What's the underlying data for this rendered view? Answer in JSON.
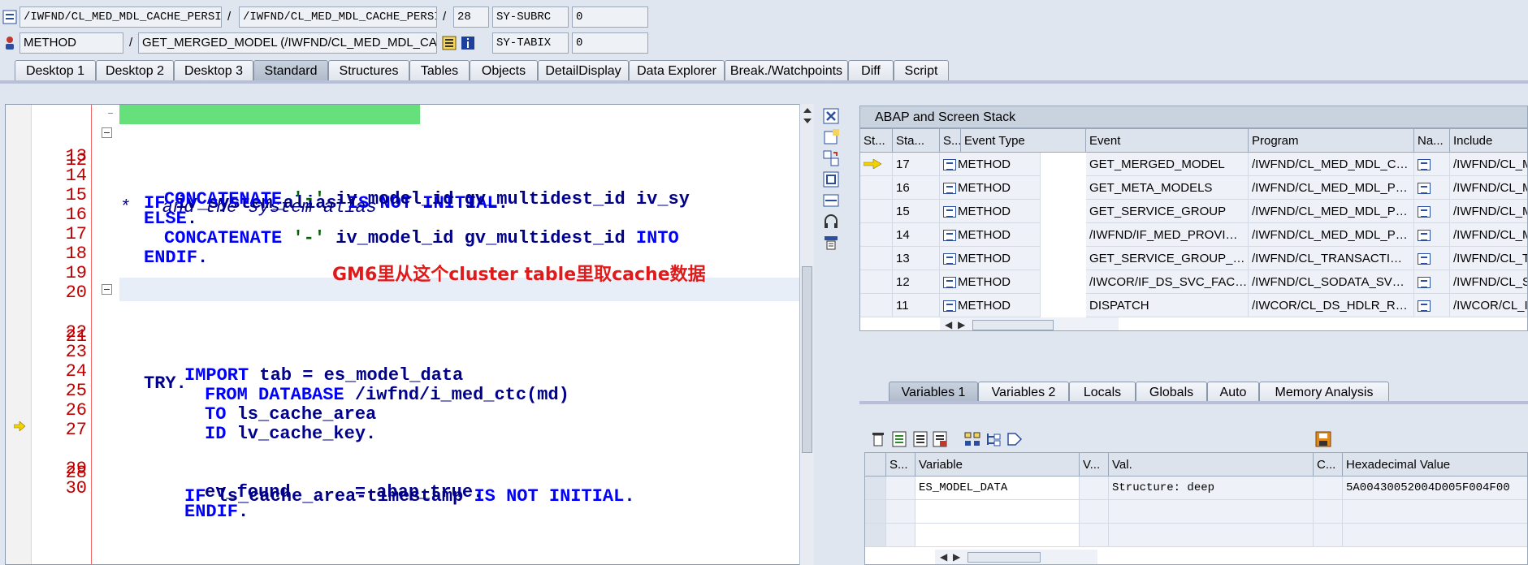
{
  "header": {
    "row1": {
      "class_field": "/IWFND/CL_MED_MDL_CACHE_PERSI…",
      "separator1": "/",
      "include_field": "/IWFND/CL_MED_MDL_CACHE_PERSI…",
      "separator2": "/",
      "line_field": "28",
      "sysvar_name": "SY-SUBRC",
      "sysvar_value": "0"
    },
    "row2": {
      "type_field": "METHOD",
      "separator": "/",
      "method_field": "GET_MERGED_MODEL (/IWFND/CL_MED_MDL_CACHE_…",
      "sysvar_name": "SY-TABIX",
      "sysvar_value": "0"
    }
  },
  "tabs": [
    {
      "label": "Desktop 1"
    },
    {
      "label": "Desktop 2"
    },
    {
      "label": "Desktop 3"
    },
    {
      "label": "Standard",
      "active": true
    },
    {
      "label": "Structures"
    },
    {
      "label": "Tables"
    },
    {
      "label": "Objects"
    },
    {
      "label": "DetailDisplay"
    },
    {
      "label": "Data Explorer"
    },
    {
      "label": "Break./Watchpoints"
    },
    {
      "label": "Diff"
    },
    {
      "label": "Script"
    }
  ],
  "editor": {
    "lines": [
      {
        "num": "12",
        "text": "*   and the system alias"
      },
      {
        "num": "13",
        "kw1": "IF",
        "t1": " iv_system_alias ",
        "kw2": "IS NOT INITIAL",
        "t2": "."
      },
      {
        "num": "14",
        "kw1": "CONCATENATE",
        "str": " '-' ",
        "t1": "iv_model_id gv_multidest_id iv_sy"
      },
      {
        "num": "15",
        "kw1": "ELSE",
        "t1": "."
      },
      {
        "num": "16",
        "kw1": "CONCATENATE",
        "str": " '-' ",
        "t1": "iv_model_id gv_multidest_id ",
        "kw2": "INTO"
      },
      {
        "num": "17",
        "kw1": "ENDIF",
        "t1": "."
      },
      {
        "num": "18"
      },
      {
        "num": "19"
      },
      {
        "num": "20"
      },
      {
        "num": "21",
        "t1": "TRY."
      },
      {
        "num": "22"
      },
      {
        "num": "23",
        "kw1": "IMPORT",
        "t1": " tab = es_model_data"
      },
      {
        "num": "24",
        "kw1": "FROM DATABASE",
        "t1": " /iwfnd/i_med_ctc(md)"
      },
      {
        "num": "25",
        "kw1": "TO",
        "t1": " ls_cache_area"
      },
      {
        "num": "26",
        "kw1": "ID",
        "t1": " lv_cache_key."
      },
      {
        "num": "27"
      },
      {
        "num": "28",
        "kw1": "IF",
        "t1": " ls_cache_area-timestamp ",
        "kw2": "IS NOT INITIAL",
        "t2": "."
      },
      {
        "num": "29",
        "t1": "ev_found      = abap_true."
      },
      {
        "num": "30",
        "kw1": "ENDIF",
        "t1": "."
      }
    ],
    "annotation": "GM6里从这个cluster table里取cache数据"
  },
  "stack": {
    "title": "ABAP and Screen Stack",
    "headers": [
      "St...",
      "Sta...",
      "S...",
      "Event Type",
      "Event",
      "Program",
      "Na...",
      "Include"
    ],
    "rows": [
      {
        "level": "17",
        "type": "METHOD",
        "event": "GET_MERGED_MODEL",
        "program": "/IWFND/CL_MED_MDL_C…",
        "include": "/IWFND/CL_M",
        "current": true
      },
      {
        "level": "16",
        "type": "METHOD",
        "event": "GET_META_MODELS",
        "program": "/IWFND/CL_MED_MDL_P…",
        "include": "/IWFND/CL_M"
      },
      {
        "level": "15",
        "type": "METHOD",
        "event": "GET_SERVICE_GROUP",
        "program": "/IWFND/CL_MED_MDL_P…",
        "include": "/IWFND/CL_M"
      },
      {
        "level": "14",
        "type": "METHOD",
        "event": "/IWFND/IF_MED_PROVI…",
        "program": "/IWFND/CL_MED_MDL_P…",
        "include": "/IWFND/CL_M"
      },
      {
        "level": "13",
        "type": "METHOD",
        "event": "GET_SERVICE_GROUP_…",
        "program": "/IWFND/CL_TRANSACTI…",
        "include": "/IWFND/CL_T"
      },
      {
        "level": "12",
        "type": "METHOD",
        "event": "/IWCOR/IF_DS_SVC_FAC…",
        "program": "/IWFND/CL_SODATA_SV…",
        "include": "/IWFND/CL_S"
      },
      {
        "level": "11",
        "type": "METHOD",
        "event": "DISPATCH",
        "program": "/IWCOR/CL_DS_HDLR_R…",
        "include": "/IWCOR/CL_I"
      }
    ]
  },
  "var_tabs": [
    {
      "label": "Variables 1",
      "active": true
    },
    {
      "label": "Variables 2"
    },
    {
      "label": "Locals"
    },
    {
      "label": "Globals"
    },
    {
      "label": "Auto"
    },
    {
      "label": "Memory Analysis"
    }
  ],
  "variables": {
    "headers": [
      "S...",
      "Variable",
      "V...",
      "Val.",
      "C...",
      "Hexadecimal Value"
    ],
    "rows": [
      {
        "name": "ES_MODEL_DATA",
        "value": "Structure: deep",
        "hex": "5A00430052004D005F004F00"
      }
    ]
  }
}
